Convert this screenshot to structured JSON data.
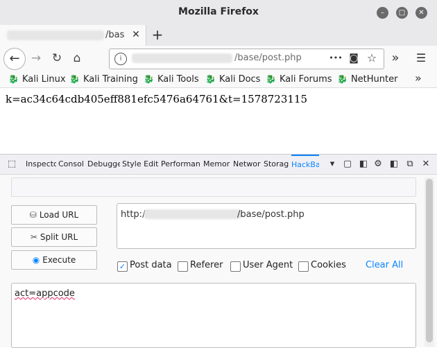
{
  "window": {
    "title": "Mozilla Firefox",
    "min_glyph": "–",
    "max_glyph": "□",
    "close_glyph": "✕"
  },
  "tab": {
    "title": "/bas",
    "close_glyph": "✕",
    "new_tab_glyph": "+"
  },
  "nav": {
    "back_glyph": "←",
    "forward_glyph": "→",
    "reload_glyph": "↻",
    "home_glyph": "⌂",
    "url_info_glyph": "i",
    "url_suffix": "/base/post.php",
    "more_glyph": "•••",
    "pocket_glyph": "◙",
    "star_glyph": "☆",
    "overflow_glyph": "»",
    "menu_glyph": "☰"
  },
  "bookmarks": {
    "dragon_glyph": "🐉",
    "items": [
      "Kali Linux",
      "Kali Training",
      "Kali Tools",
      "Kali Docs",
      "Kali Forums",
      "NetHunter"
    ],
    "more_glyph": "»"
  },
  "page": {
    "text": "k=ac34c64cdb405eff881efc5476a64761&t=1578723115"
  },
  "devtools": {
    "tabs": [
      "Inspecto",
      "Consol",
      "Debugge",
      "Style Edit",
      "Performan",
      "Memor",
      "Networ",
      "Storag",
      "HackBa"
    ],
    "pick_glyph": "⬚",
    "chevron_glyph": "▾",
    "dock_glyph": "▢",
    "split_glyph": "◧",
    "settings_glyph": "⚙",
    "popout_glyph": "⧉",
    "close_glyph": "✕"
  },
  "hackbar": {
    "load_url": "Load URL",
    "split_url": "Split URL",
    "execute": "Execute",
    "load_glyph": "⛁",
    "split_glyph": "✂",
    "execute_glyph": "◉",
    "url_prefix": "http://",
    "url_suffix": "/base/post.php",
    "options": {
      "post_data": "Post data",
      "referer": "Referer",
      "user_agent": "User Agent",
      "cookies": "Cookies"
    },
    "checked_glyph": "✓",
    "clear_all": "Clear All",
    "post_body": "act=appcode"
  },
  "colors": {
    "accent": "#0a84ff",
    "chrome": "#e9e9ec",
    "toolbar": "#f9f9fa"
  }
}
